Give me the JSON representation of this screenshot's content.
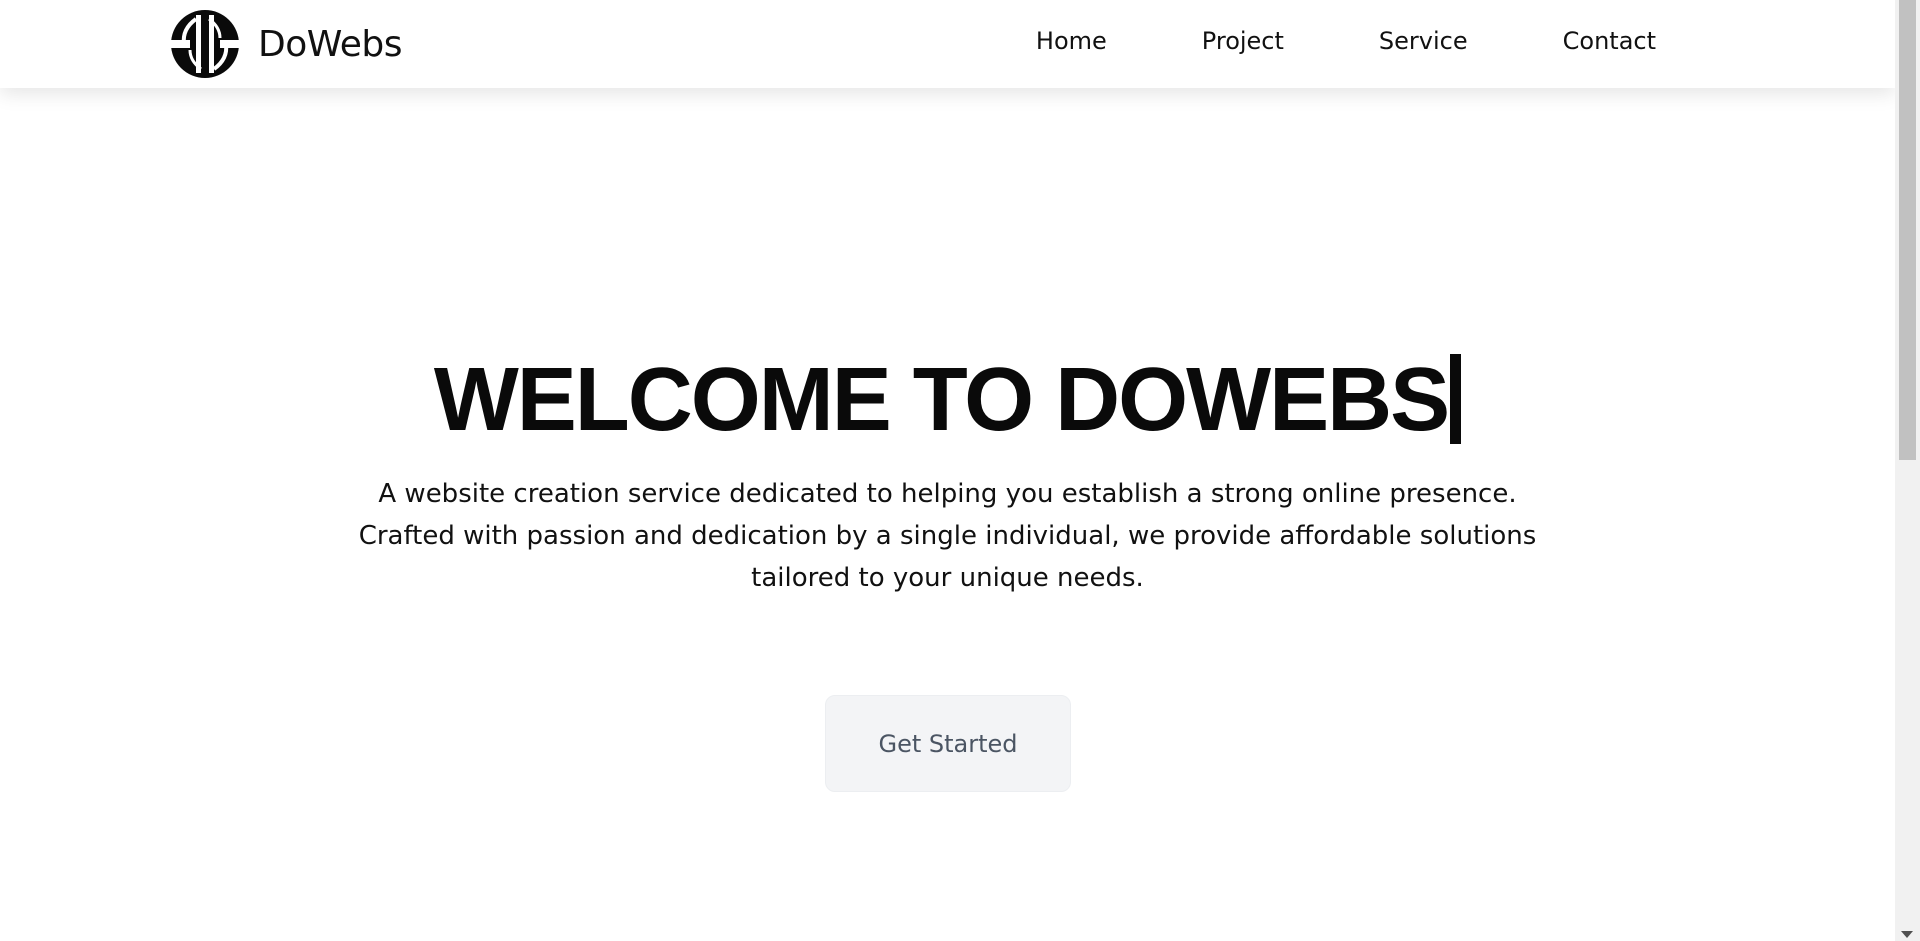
{
  "header": {
    "brand_name": "DoWebs",
    "logo_icon": "dowebs-logo-icon",
    "nav": [
      {
        "label": "Home"
      },
      {
        "label": "Project"
      },
      {
        "label": "Service"
      },
      {
        "label": "Contact"
      }
    ]
  },
  "hero": {
    "title": "WELCOME TO DOWEBS",
    "description_line_1": "A website creation service dedicated to helping you establish a strong online presence.",
    "description_line_2": "Crafted with passion and dedication by a single individual, we provide affordable solutions",
    "description_line_3": "tailored to your unique needs.",
    "cta_label": "Get Started"
  },
  "colors": {
    "text": "#111111",
    "cta_bg": "#f3f4f6",
    "cta_text": "#4b5563",
    "scrollbar_thumb": "#c1c1c1"
  }
}
